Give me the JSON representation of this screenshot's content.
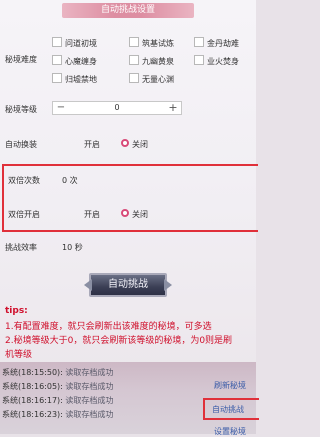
{
  "title": "自动挑战设置",
  "difficulty": {
    "label": "秘境难度",
    "options": [
      "问道初境",
      "筑基试炼",
      "金丹劫难",
      "心魔缠身",
      "九幽黄泉",
      "业火焚身",
      "归墟禁地",
      "无量心渊"
    ]
  },
  "level": {
    "label": "秘境等级",
    "minus": "−",
    "value": "0",
    "plus": "+"
  },
  "auto_switch": {
    "label": "自动换装",
    "on": "开启",
    "off": "关闭",
    "selected": "off"
  },
  "double_count": {
    "label": "双倍次数",
    "value": "0 次"
  },
  "double_enable": {
    "label": "双倍开启",
    "on": "开启",
    "off": "关闭",
    "selected": "off"
  },
  "efficiency": {
    "label": "挑战效率",
    "value": "10 秒"
  },
  "start_button": "自动挑战",
  "tips": {
    "heading": "tips:",
    "line1": "1.有配置难度，就只会刷新出该难度的秘境，可多选",
    "line2a": "2.秘境等级大于0，就只会刷新该等级的秘境，为0则是刷",
    "line2b": "机等级"
  },
  "log": [
    {
      "ts": "系统(18:15:50):",
      "msg": "读取存档成功"
    },
    {
      "ts": "系统(18:16:05):",
      "msg": "读取存档成功"
    },
    {
      "ts": "系统(18:16:17):",
      "msg": "读取存档成功"
    },
    {
      "ts": "系统(18:16:23):",
      "msg": "读取存档成功"
    }
  ],
  "side_buttons": {
    "refresh": "刷新秘境",
    "auto": "自动挑战",
    "settings": "设置秘境"
  },
  "colors": {
    "accent": "#d84a78",
    "highlight_border": "#e0303a",
    "tips": "#d0102c"
  }
}
